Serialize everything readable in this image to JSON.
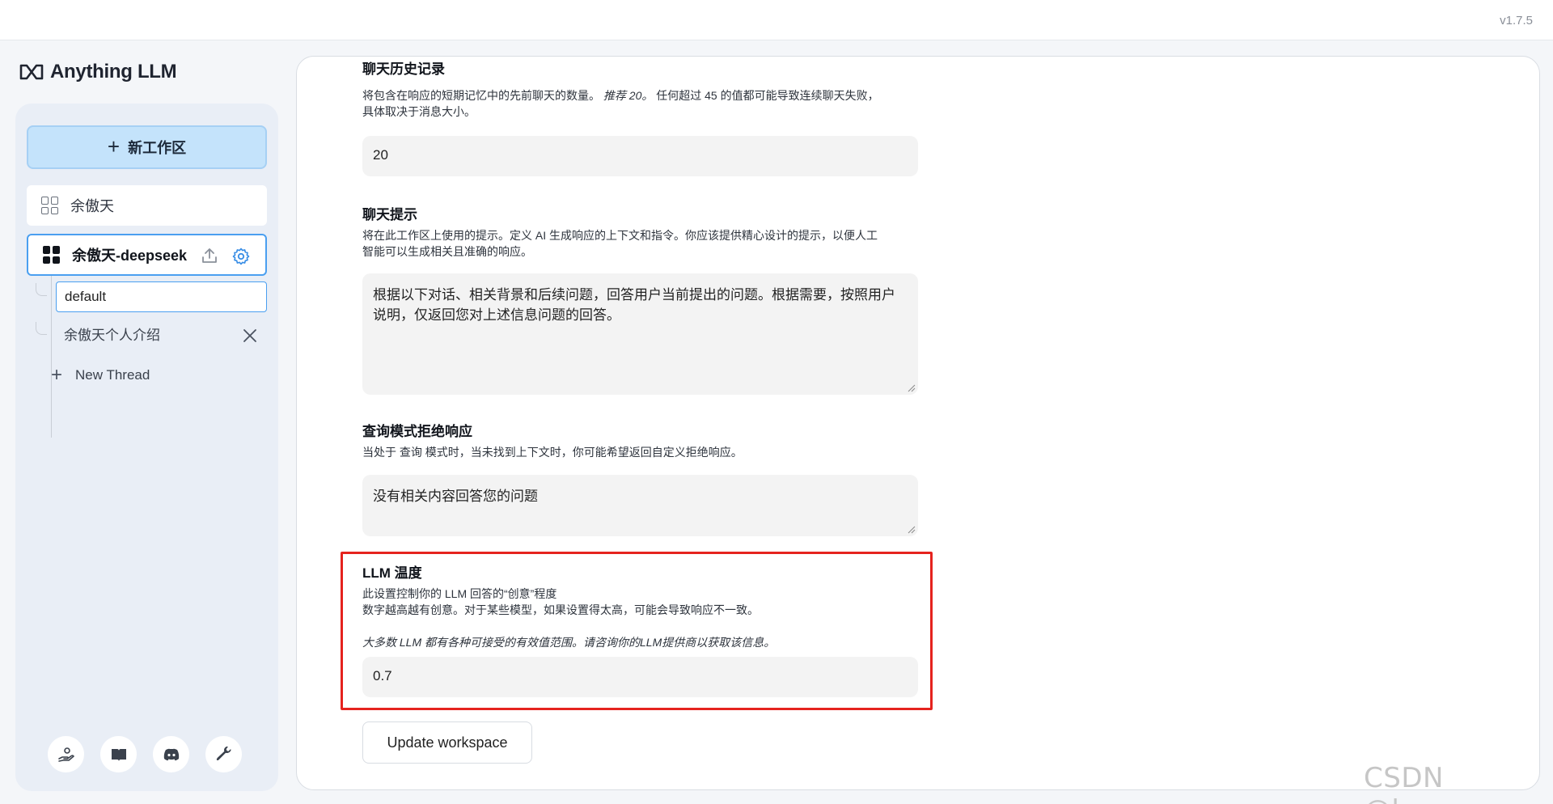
{
  "header": {
    "version": "v1.7.5"
  },
  "brand": {
    "name": "Anything LLM"
  },
  "sidebar": {
    "new_workspace_label": "新工作区",
    "workspaces": [
      {
        "name": "余傲天"
      },
      {
        "name": "余傲天-deepseek",
        "active": true
      }
    ],
    "threads": [
      {
        "name": "default",
        "editing": true
      },
      {
        "name": "余傲天个人介绍"
      }
    ],
    "new_thread_label": "New Thread",
    "footer_icons": [
      "community-hub-icon",
      "docs-book-icon",
      "discord-icon",
      "settings-wrench-icon"
    ]
  },
  "settings": {
    "chat_history": {
      "title": "聊天历史记录",
      "desc_line1_a": "将包含在响应的短期记忆中的先前聊天的数量。",
      "desc_line1_em": "推荐 20。",
      "desc_line1_b": "任何超过 45 的值都可能导致连续聊天失败，",
      "desc_line2": "具体取决于消息大小。",
      "value": "20"
    },
    "chat_prompt": {
      "title": "聊天提示",
      "desc_line1": "将在此工作区上使用的提示。定义 AI 生成响应的上下文和指令。你应该提供精心设计的提示，以便人工",
      "desc_line2": "智能可以生成相关且准确的响应。",
      "value": "根据以下对话、相关背景和后续问题，回答用户当前提出的问题。根据需要，按照用户说明，仅返回您对上述信息问题的回答。"
    },
    "query_refusal": {
      "title": "查询模式拒绝响应",
      "desc": "当处于 查询 模式时，当未找到上下文时，你可能希望返回自定义拒绝响应。",
      "value": "没有相关内容回答您的问题"
    },
    "llm_temperature": {
      "title": "LLM 温度",
      "desc_line1": "此设置控制你的 LLM 回答的“创意”程度",
      "desc_line2": "数字越高越有创意。对于某些模型，如果设置得太高，可能会导致响应不一致。",
      "note": "大多数 LLM 都有各种可接受的有效值范围。请咨询你的LLM提供商以获取该信息。",
      "value": "0.7"
    },
    "update_button": "Update workspace"
  },
  "watermark": "CSDN @kocor",
  "colors": {
    "accent": "#4a9ff0",
    "highlight": "#e5231e",
    "new_ws_bg": "#c4e3fb"
  }
}
